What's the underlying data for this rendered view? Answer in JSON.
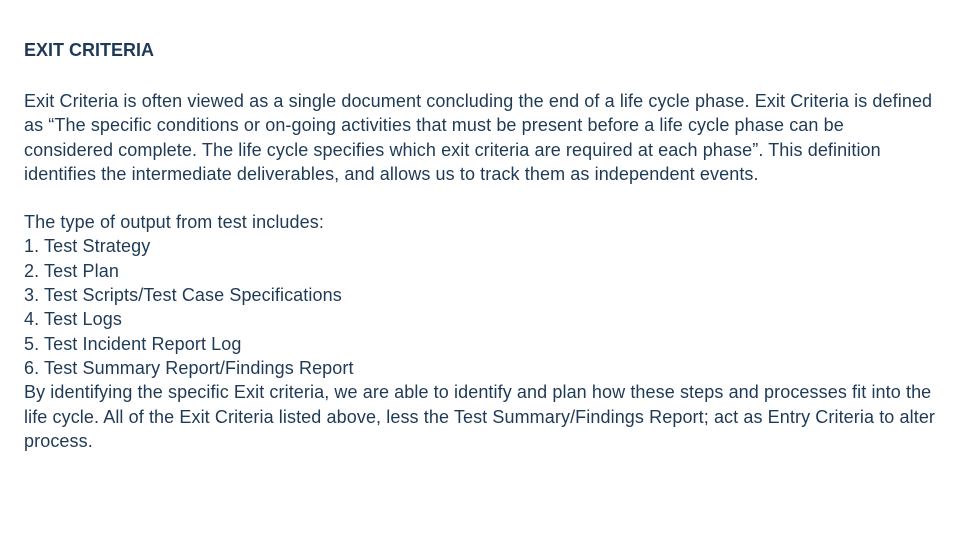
{
  "title": "EXIT CRITERIA",
  "para1": "Exit Criteria is often viewed as a single document concluding the end of a life cycle phase. Exit Criteria is defined as “The specific conditions or on-going activities that must be present before a life cycle phase can be considered complete. The life cycle specifies which exit criteria are required at each phase”. This definition identifies the intermediate deliverables, and allows us to track them as independent events.",
  "block2": {
    "intro": "The type of output from test includes:",
    "items": [
      "1. Test Strategy",
      "2. Test Plan",
      "3. Test Scripts/Test Case Specifications",
      "4. Test Logs",
      "5. Test Incident Report Log",
      "6. Test Summary Report/Findings Report"
    ],
    "outro": "By identifying the specific Exit criteria, we are able to identify and plan how these steps and processes fit into the life cycle. All of the Exit Criteria listed above, less the Test Summary/Findings Report; act as Entry Criteria to alter process."
  }
}
